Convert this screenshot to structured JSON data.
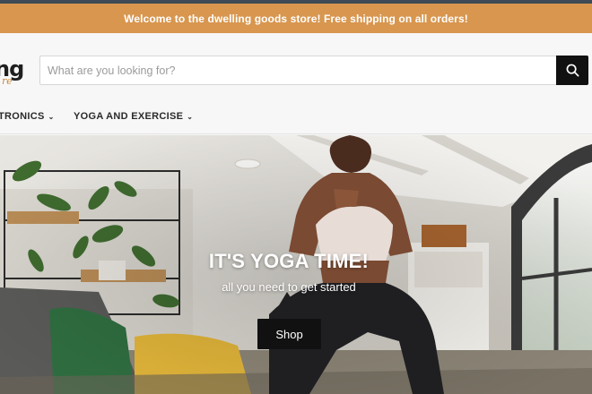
{
  "announcement": {
    "text": "Welcome to the dwelling goods store! Free shipping on all orders!"
  },
  "brand": {
    "logo_text": "ng",
    "logo_tagline": "re",
    "accent_color": "#d8964f"
  },
  "search": {
    "placeholder": "What are you looking for?",
    "value": "",
    "icon": "search-icon"
  },
  "nav": {
    "items": [
      {
        "label": "TRONICS",
        "icon": "chevron-down-icon"
      },
      {
        "label": "YOGA AND EXERCISE",
        "icon": "chevron-down-icon"
      }
    ]
  },
  "hero": {
    "title": "IT'S YOGA TIME!",
    "subtitle": "all you need to get started",
    "cta_label": "Shop"
  }
}
